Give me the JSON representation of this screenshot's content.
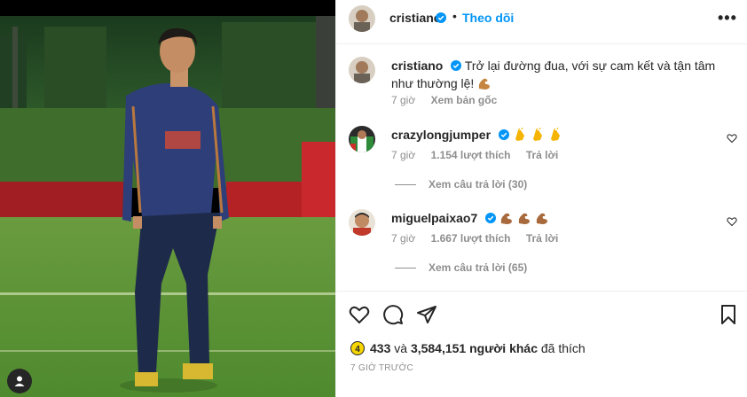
{
  "post": {
    "author": "cristiano",
    "follow_label": "Theo dõi",
    "dot": "•",
    "more": "•••"
  },
  "caption": {
    "author": "cristiano",
    "text": "Trở lại đường đua, với sự cam kết và tận tâm như thường lệ!",
    "time": "7 giờ",
    "see_original": "Xem bản gốc"
  },
  "comments": [
    {
      "author": "crazylongjumper",
      "emoji": "clapping-hands x3",
      "time": "7 giờ",
      "likes": "1.154 lượt thích",
      "reply": "Trả lời",
      "view_replies": "Xem câu trả lời (30)"
    },
    {
      "author": "miguelpaixao7",
      "emoji": "flexed-biceps x3",
      "time": "7 giờ",
      "likes": "1.667 lượt thích",
      "reply": "Trả lời",
      "view_replies": "Xem câu trả lời (65)"
    }
  ],
  "likes_line": {
    "badge": "4",
    "first": "433",
    "connector": "và",
    "count": "3,584,151 người khác",
    "suffix": "đã thích"
  },
  "timestamp": "7 GIỜ TRƯỚC",
  "colors": {
    "link": "#0095f6",
    "muted": "#8e8e8e",
    "text": "#262626",
    "verified": "#0095f6"
  },
  "icons": [
    "heart-icon",
    "comment-icon",
    "share-icon",
    "bookmark-icon",
    "verified-icon",
    "user-tag-icon",
    "more-icon"
  ]
}
